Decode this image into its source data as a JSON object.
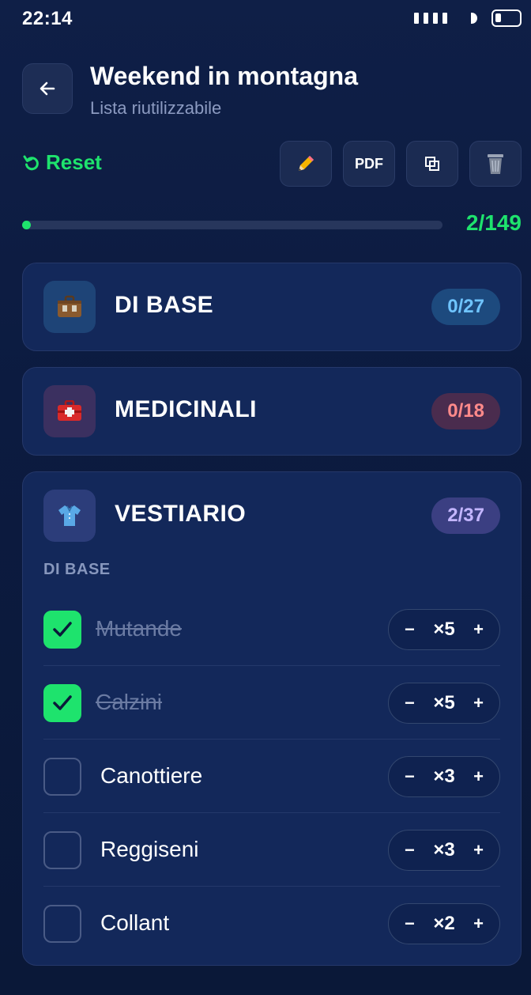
{
  "status_bar": {
    "time": "22:14"
  },
  "header": {
    "title": "Weekend in montagna",
    "subtitle": "Lista riutilizzabile"
  },
  "toolbar": {
    "reset_label": "Reset",
    "pdf_label": "PDF"
  },
  "progress": {
    "count_label": "2/149",
    "done": 2,
    "total": 149
  },
  "categories": [
    {
      "name": "DI BASE",
      "badge": "0/27",
      "icon": "suitcase-icon"
    },
    {
      "name": "MEDICINALI",
      "badge": "0/18",
      "icon": "first-aid-kit-icon"
    },
    {
      "name": "VESTIARIO",
      "badge": "2/37",
      "icon": "shirt-icon",
      "section_label": "DI BASE",
      "items": [
        {
          "label": "Mutande",
          "qty": "×5",
          "checked": true
        },
        {
          "label": "Calzini",
          "qty": "×5",
          "checked": true
        },
        {
          "label": "Canottiere",
          "qty": "×3",
          "checked": false
        },
        {
          "label": "Reggiseni",
          "qty": "×3",
          "checked": false
        },
        {
          "label": "Collant",
          "qty": "×2",
          "checked": false
        }
      ]
    }
  ],
  "qty_controls": {
    "minus": "−",
    "plus": "+"
  },
  "colors": {
    "accent": "#1ee36d",
    "card": "#13285a",
    "background": "#0c1b40"
  }
}
